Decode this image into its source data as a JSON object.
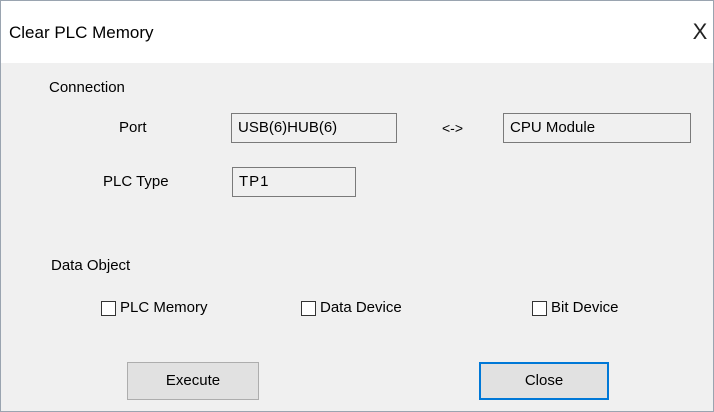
{
  "window": {
    "title": "Clear PLC Memory",
    "close_glyph": "X"
  },
  "connection": {
    "group_label": "Connection",
    "port_label": "Port",
    "port_value": "USB(6)HUB(6)",
    "arrow": "<->",
    "target_value": "CPU Module",
    "plc_type_label": "PLC Type",
    "plc_type_value": "TP1"
  },
  "data_object": {
    "group_label": "Data Object",
    "options": [
      {
        "label": "PLC Memory",
        "checked": false
      },
      {
        "label": "Data Device",
        "checked": false
      },
      {
        "label": "Bit Device",
        "checked": false
      }
    ]
  },
  "buttons": {
    "execute_label": "Execute",
    "close_label": "Close"
  },
  "colors": {
    "dialog_bg": "#f0f0f0",
    "title_bg": "#ffffff",
    "focus_border": "#0078d7"
  }
}
